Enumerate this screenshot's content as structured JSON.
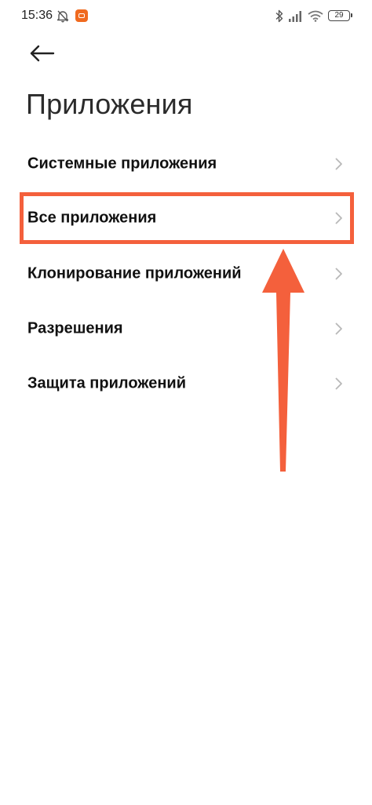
{
  "status_bar": {
    "time": "15:36",
    "battery_level": "29",
    "icons": [
      "alarm-off-icon",
      "notification-app-icon",
      "bluetooth-icon",
      "signal-icon",
      "wifi-icon",
      "battery-icon"
    ]
  },
  "header": {
    "back_icon": "arrow-left-icon",
    "title": "Приложения"
  },
  "menu": {
    "items": [
      {
        "label": "Системные приложения",
        "icon": "chevron-right-icon"
      },
      {
        "label": "Все приложения",
        "icon": "chevron-right-icon"
      },
      {
        "label": "Клонирование приложений",
        "icon": "chevron-right-icon"
      },
      {
        "label": "Разрешения",
        "icon": "chevron-right-icon"
      },
      {
        "label": "Защита приложений",
        "icon": "chevron-right-icon"
      }
    ]
  },
  "annotation": {
    "highlight_color": "#f4603c",
    "highlighted_item": "Все приложения"
  }
}
